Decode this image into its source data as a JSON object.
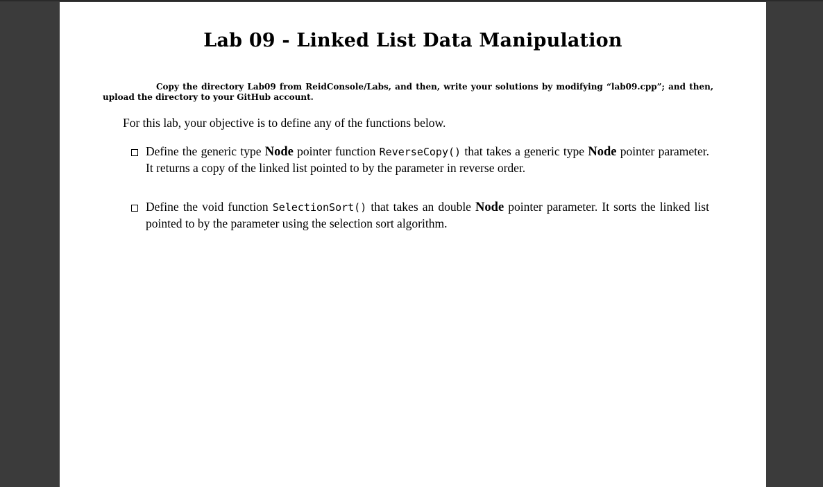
{
  "document": {
    "title": "Lab 09 - Linked List Data Manipulation",
    "abstract": "Copy the directory Lab09 from ReidConsole/Labs, and then, write your solutions by modifying “lab09.cpp”; and then, upload the directory to your GitHub account.",
    "intro": "For this lab, your objective is to define any of the functions below.",
    "items": [
      {
        "p1": "Define the generic type ",
        "b1": "Node",
        "p2": " pointer function ",
        "code": "ReverseCopy()",
        "p3": " that takes a generic type ",
        "b2": "Node",
        "p4": " pointer parameter. It returns a copy of the linked list pointed to by the parameter in reverse order."
      },
      {
        "p1": "Define the void function ",
        "code": "SelectionSort()",
        "p2": " that takes an double ",
        "b1": "Node",
        "p3": " pointer parameter. It sorts the linked list pointed to by the parameter using the selection sort algorithm."
      }
    ]
  },
  "colors": {
    "viewer_background": "#3b3b3b",
    "page_background": "#ffffff",
    "text": "#000000"
  },
  "icons": {
    "checkbox": "empty-square-bullet-icon"
  }
}
